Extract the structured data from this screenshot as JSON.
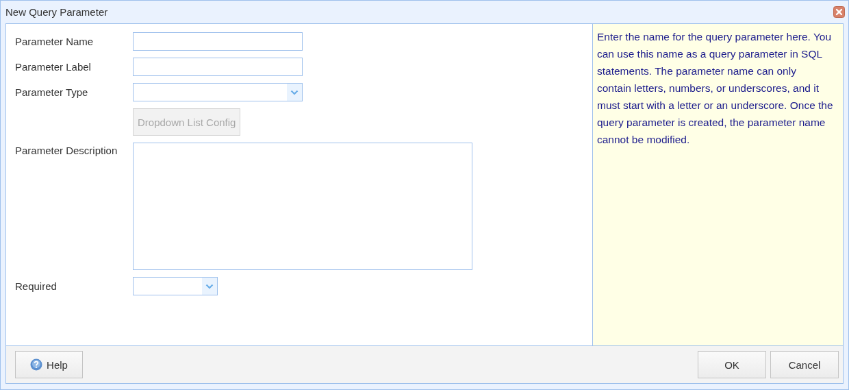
{
  "window": {
    "title": "New Query Parameter"
  },
  "fields": [
    {
      "kind": "text",
      "label": "Parameter Name"
    },
    {
      "kind": "text",
      "label": "Parameter Label"
    },
    {
      "kind": "select",
      "label": "Parameter Type"
    },
    {
      "kind": "button",
      "text": "Dropdown List Config",
      "disabled": true
    },
    {
      "kind": "textarea",
      "label": "Parameter Description"
    },
    {
      "kind": "combo",
      "label": "Required"
    }
  ],
  "help_text": "Enter the name for the query parameter here. You can use this name as a query parameter in SQL statements. The parameter name can only contain letters, numbers, or underscores, and it must start with a letter or an underscore. Once the query parameter is created, the parameter name cannot be modified.",
  "footer": {
    "help_button": "Help",
    "buttons": [
      "OK",
      "Cancel"
    ]
  }
}
